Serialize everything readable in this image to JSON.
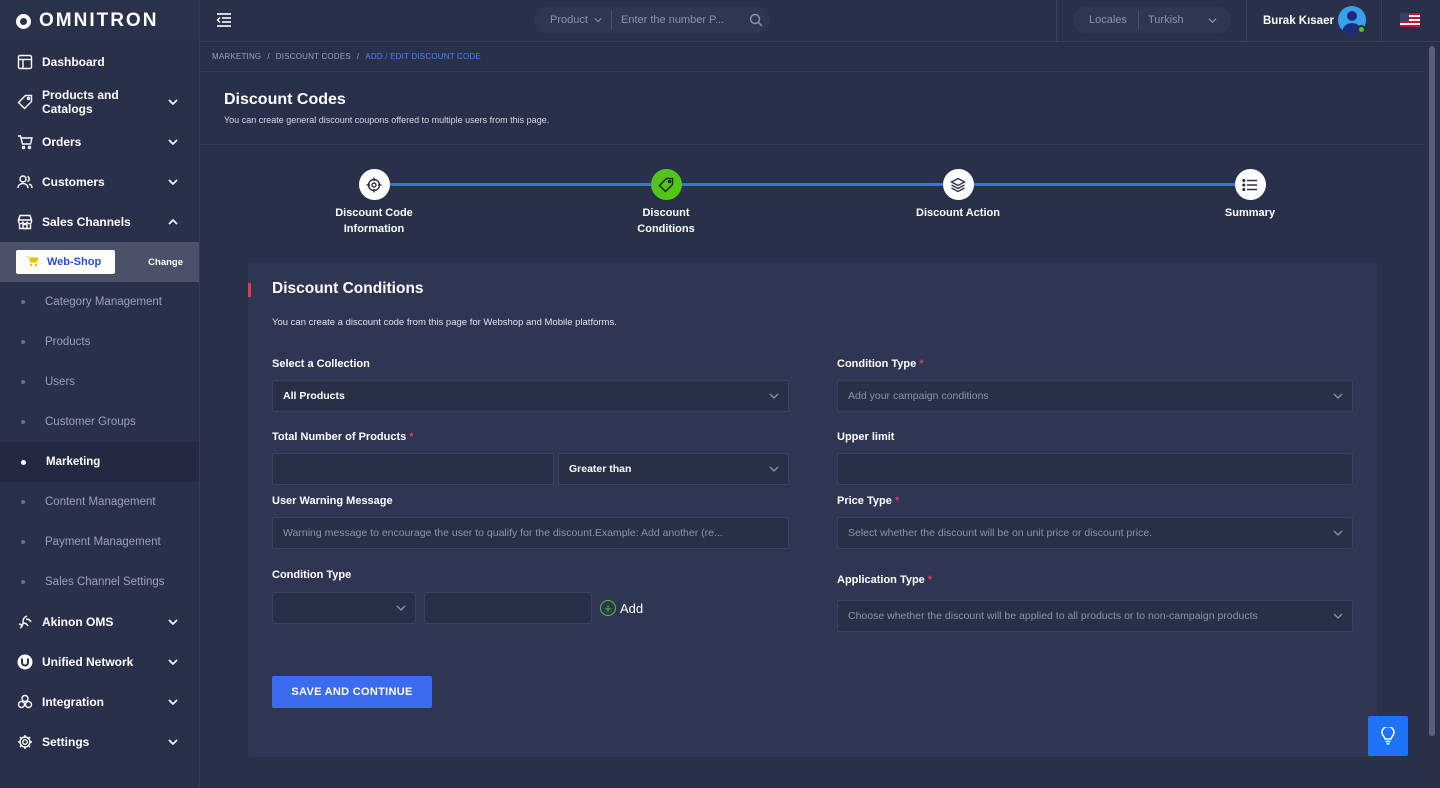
{
  "app": {
    "logo_text": "OMNITRON"
  },
  "sidebar": {
    "items": [
      {
        "label": "Dashboard"
      },
      {
        "label": "Products and Catalogs"
      },
      {
        "label": "Orders"
      },
      {
        "label": "Customers"
      },
      {
        "label": "Sales Channels"
      }
    ],
    "channel": {
      "name": "Web-Shop",
      "change_label": "Change"
    },
    "sub_items": [
      {
        "label": "Category Management"
      },
      {
        "label": "Products"
      },
      {
        "label": "Users"
      },
      {
        "label": "Customer Groups"
      },
      {
        "label": "Marketing"
      },
      {
        "label": "Content Management"
      },
      {
        "label": "Payment Management"
      },
      {
        "label": "Sales Channel Settings"
      }
    ],
    "bottom_items": [
      {
        "label": "Akinon OMS"
      },
      {
        "label": "Unified Network"
      },
      {
        "label": "Integration"
      },
      {
        "label": "Settings"
      }
    ]
  },
  "topbar": {
    "search_type": "Product",
    "search_placeholder": "Enter the number P...",
    "locales_label": "Locales",
    "locale_value": "Turkish",
    "user_name": "Burak Kısaer"
  },
  "breadcrumb": {
    "items": [
      "MARKETING",
      "DISCOUNT CODES",
      "ADD / EDIT DISCOUNT CODE"
    ],
    "separator": "/"
  },
  "page": {
    "title": "Discount Codes",
    "subtitle": "You can create general discount coupons offered to multiple users from this page."
  },
  "stepper": {
    "steps": [
      {
        "line1": "Discount Code",
        "line2": "Information",
        "icon": "target-icon"
      },
      {
        "line1": "Discount",
        "line2": "Conditions",
        "icon": "tag-icon"
      },
      {
        "line1": "Discount Action",
        "line2": "",
        "icon": "layers-icon"
      },
      {
        "line1": "Summary",
        "line2": "",
        "icon": "list-icon"
      }
    ],
    "active_index": 1
  },
  "form": {
    "title": "Discount Conditions",
    "subtitle": "You can create a discount code from this page for Webshop and Mobile platforms.",
    "collection_label": "Select a Collection",
    "collection_value": "All Products",
    "condition_type_label": "Condition Type",
    "condition_type_placeholder": "Add your campaign conditions",
    "total_products_label": "Total Number of Products",
    "total_products_value": "",
    "comparison_value": "Greater than",
    "upper_limit_label": "Upper limit",
    "upper_limit_value": "",
    "warning_label": "User Warning Message",
    "warning_placeholder": "Warning message to encourage the user to qualify for the discount.Example: Add another (re...",
    "price_type_label": "Price Type",
    "price_type_placeholder": "Select whether the discount will be on unit price or discount price.",
    "condition_type2_label": "Condition Type",
    "condition_type2_value": "",
    "condition_value": "",
    "add_label": "Add",
    "application_type_label": "Application Type",
    "application_type_placeholder": "Choose whether the discount will be applied to all products or to non-campaign products",
    "save_label": "SAVE AND CONTINUE",
    "required_mark": "*"
  },
  "colors": {
    "background": "#293049",
    "card": "#2f3654",
    "accent": "#3d6bf0",
    "success": "#52c41a",
    "required": "#e53950"
  }
}
